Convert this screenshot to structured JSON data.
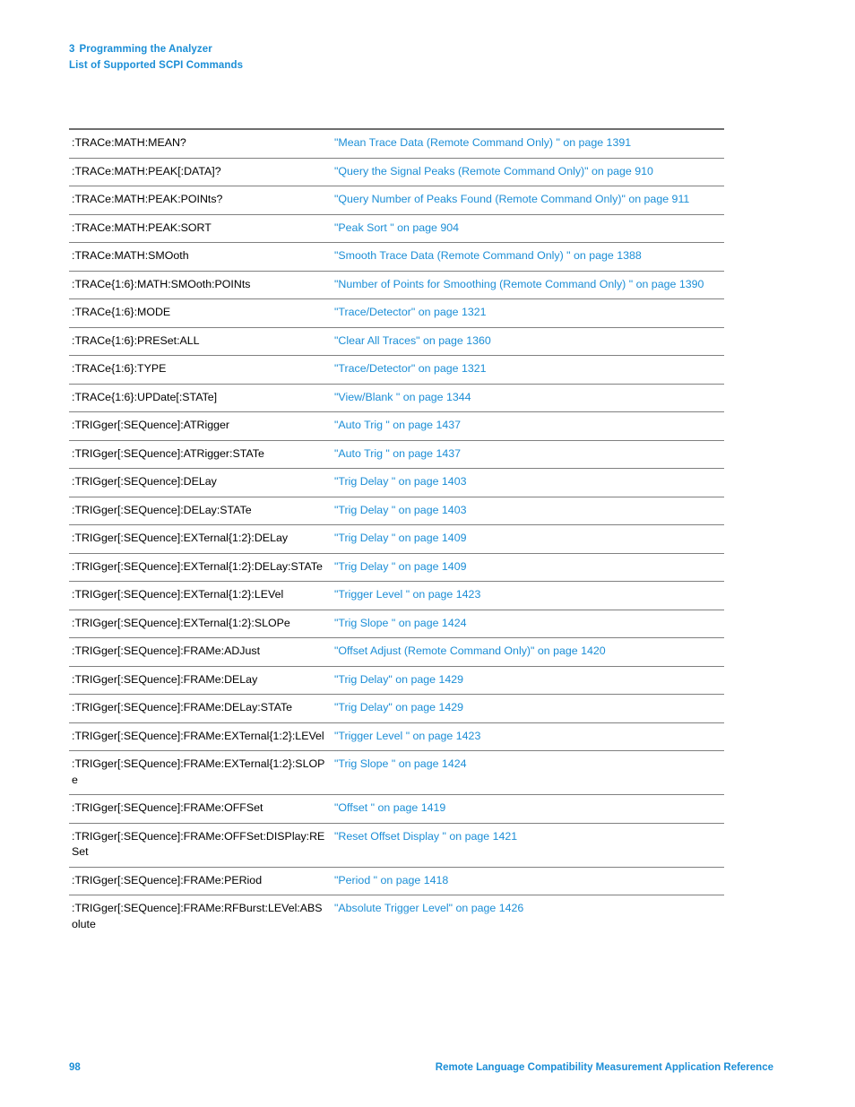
{
  "header": {
    "chapter_number": "3",
    "chapter_title": "Programming the Analyzer",
    "section_title": "List of Supported SCPI Commands"
  },
  "colors": {
    "link_blue": "#1b8ed6",
    "rule_gray": "#808080",
    "body_black": "#000000"
  },
  "table": {
    "rows": [
      {
        "command": ":TRACe:MATH:MEAN?",
        "reference": "\"Mean Trace Data (Remote Command Only) \" on page 1391"
      },
      {
        "command": ":TRACe:MATH:PEAK[:DATA]?",
        "reference": "\"Query the Signal Peaks (Remote Command Only)\" on page 910"
      },
      {
        "command": ":TRACe:MATH:PEAK:POINts?",
        "reference": "\"Query Number of Peaks Found (Remote Command Only)\" on page 911"
      },
      {
        "command": ":TRACe:MATH:PEAK:SORT",
        "reference": "\"Peak Sort \" on page 904"
      },
      {
        "command": ":TRACe:MATH:SMOoth",
        "reference": "\"Smooth Trace Data (Remote Command Only) \" on page 1388"
      },
      {
        "command": ":TRACe{1:6}:MATH:SMOoth:POINts",
        "reference": "\"Number of Points for Smoothing (Remote Command Only) \" on page 1390"
      },
      {
        "command": ":TRACe{1:6}:MODE",
        "reference": "\"Trace/Detector\" on page 1321"
      },
      {
        "command": ":TRACe{1:6}:PRESet:ALL",
        "reference": "\"Clear All Traces\" on page 1360"
      },
      {
        "command": ":TRACe{1:6}:TYPE",
        "reference": "\"Trace/Detector\" on page 1321"
      },
      {
        "command": ":TRACe{1:6}:UPDate[:STATe]",
        "reference": "\"View/Blank \" on page 1344"
      },
      {
        "command": ":TRIGger[:SEQuence]:ATRigger",
        "reference": "\"Auto Trig \" on page 1437"
      },
      {
        "command": ":TRIGger[:SEQuence]:ATRigger:STATe",
        "reference": "\"Auto Trig \" on page 1437"
      },
      {
        "command": ":TRIGger[:SEQuence]:DELay",
        "reference": "\"Trig Delay \" on page 1403"
      },
      {
        "command": ":TRIGger[:SEQuence]:DELay:STATe",
        "reference": "\"Trig Delay \" on page 1403"
      },
      {
        "command": ":TRIGger[:SEQuence]:EXTernal{1:2}:DELay",
        "reference": "\"Trig Delay \" on page 1409"
      },
      {
        "command": ":TRIGger[:SEQuence]:EXTernal{1:2}:DELay:STATe",
        "reference": "\"Trig Delay \" on page 1409"
      },
      {
        "command": ":TRIGger[:SEQuence]:EXTernal{1:2}:LEVel",
        "reference": "\"Trigger Level \" on page 1423"
      },
      {
        "command": ":TRIGger[:SEQuence]:EXTernal{1:2}:SLOPe",
        "reference": "\"Trig Slope \" on page 1424"
      },
      {
        "command": ":TRIGger[:SEQuence]:FRAMe:ADJust",
        "reference": "\"Offset Adjust (Remote Command Only)\" on page 1420"
      },
      {
        "command": ":TRIGger[:SEQuence]:FRAMe:DELay",
        "reference": "\"Trig Delay\" on page 1429"
      },
      {
        "command": ":TRIGger[:SEQuence]:FRAMe:DELay:STATe",
        "reference": "\"Trig Delay\" on page 1429"
      },
      {
        "command": ":TRIGger[:SEQuence]:FRAMe:EXTernal{1:2}:LEVel",
        "reference": "\"Trigger Level \" on page 1423"
      },
      {
        "command": ":TRIGger[:SEQuence]:FRAMe:EXTernal{1:2}:SLOPe",
        "reference": "\"Trig Slope \" on page 1424"
      },
      {
        "command": ":TRIGger[:SEQuence]:FRAMe:OFFSet",
        "reference": "\"Offset \" on page 1419"
      },
      {
        "command": ":TRIGger[:SEQuence]:FRAMe:OFFSet:DISPlay:RESet",
        "reference": "\"Reset Offset Display \" on page 1421"
      },
      {
        "command": ":TRIGger[:SEQuence]:FRAMe:PERiod",
        "reference": "\"Period \" on page 1418"
      },
      {
        "command": ":TRIGger[:SEQuence]:FRAMe:RFBurst:LEVel:ABSolute",
        "reference": "\"Absolute Trigger Level\" on page 1426"
      }
    ]
  },
  "footer": {
    "page_number": "98",
    "document_title": "Remote Language Compatibility Measurement Application Reference"
  }
}
